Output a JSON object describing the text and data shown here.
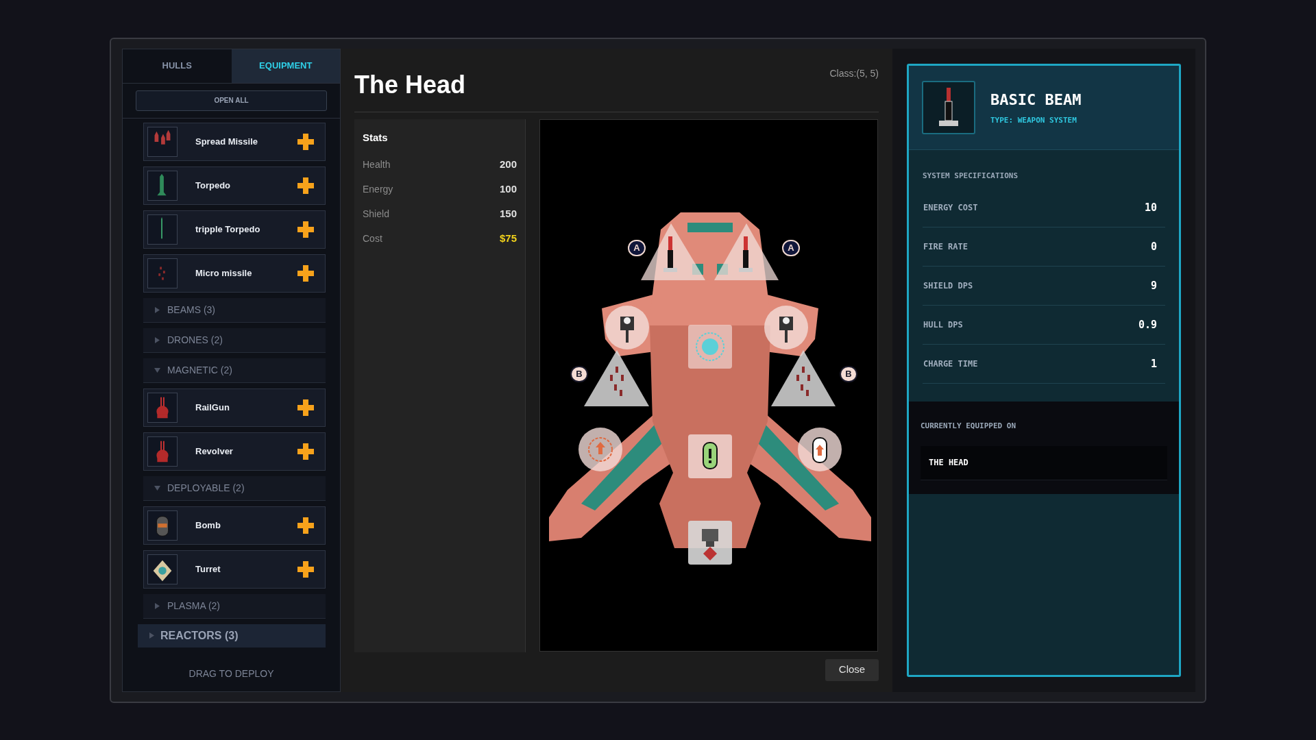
{
  "tabs": [
    {
      "label": "HULLS",
      "selected": false
    },
    {
      "label": "EQUIPMENT",
      "selected": true
    }
  ],
  "open_all_button": "OPEN ALL",
  "equipment_list": [
    {
      "kind": "item",
      "name": "Spread Missile"
    },
    {
      "kind": "item",
      "name": "Torpedo"
    },
    {
      "kind": "item",
      "name": "tripple Torpedo"
    },
    {
      "kind": "item",
      "name": "Micro missile"
    },
    {
      "kind": "category",
      "label": "BEAMS (3)",
      "expanded": false
    },
    {
      "kind": "category",
      "label": "DRONES (2)",
      "expanded": false
    },
    {
      "kind": "category",
      "label": "MAGNETIC (2)",
      "expanded": true
    },
    {
      "kind": "item",
      "name": "RailGun"
    },
    {
      "kind": "item",
      "name": "Revolver"
    },
    {
      "kind": "category",
      "label": "DEPLOYABLE (2)",
      "expanded": true
    },
    {
      "kind": "item",
      "name": "Bomb"
    },
    {
      "kind": "item",
      "name": "Turret"
    },
    {
      "kind": "category",
      "label": "PLASMA (2)",
      "expanded": false
    },
    {
      "kind": "group",
      "label": "REACTORS (3)",
      "expanded": false
    }
  ],
  "footer_hint": "DRAG TO DEPLOY",
  "ship": {
    "name": "The Head",
    "class": "Class:(5, 5)",
    "stats_title": "Stats",
    "stats": [
      {
        "label": "Health",
        "value": "200",
        "kind": "number"
      },
      {
        "label": "Energy",
        "value": "100",
        "kind": "number"
      },
      {
        "label": "Shield",
        "value": "150",
        "kind": "number"
      },
      {
        "label": "Cost",
        "value": "$75",
        "kind": "cost"
      }
    ],
    "slot_badges": [
      {
        "label": "A"
      },
      {
        "label": "A"
      },
      {
        "label": "B"
      },
      {
        "label": "B"
      }
    ]
  },
  "close_button": "Close",
  "detail": {
    "name": "BASIC BEAM",
    "type": "TYPE: WEAPON SYSTEM",
    "specs_title": "SYSTEM SPECIFICATIONS",
    "specs": [
      {
        "label": "ENERGY COST",
        "value": "10"
      },
      {
        "label": "FIRE RATE",
        "value": "0"
      },
      {
        "label": "SHIELD DPS",
        "value": "9"
      },
      {
        "label": "HULL DPS",
        "value": "0.9"
      },
      {
        "label": "CHARGE TIME",
        "value": "1"
      }
    ],
    "equipped_title": "CURRENTLY EQUIPPED ON",
    "equipped": [
      "THE HEAD"
    ]
  }
}
